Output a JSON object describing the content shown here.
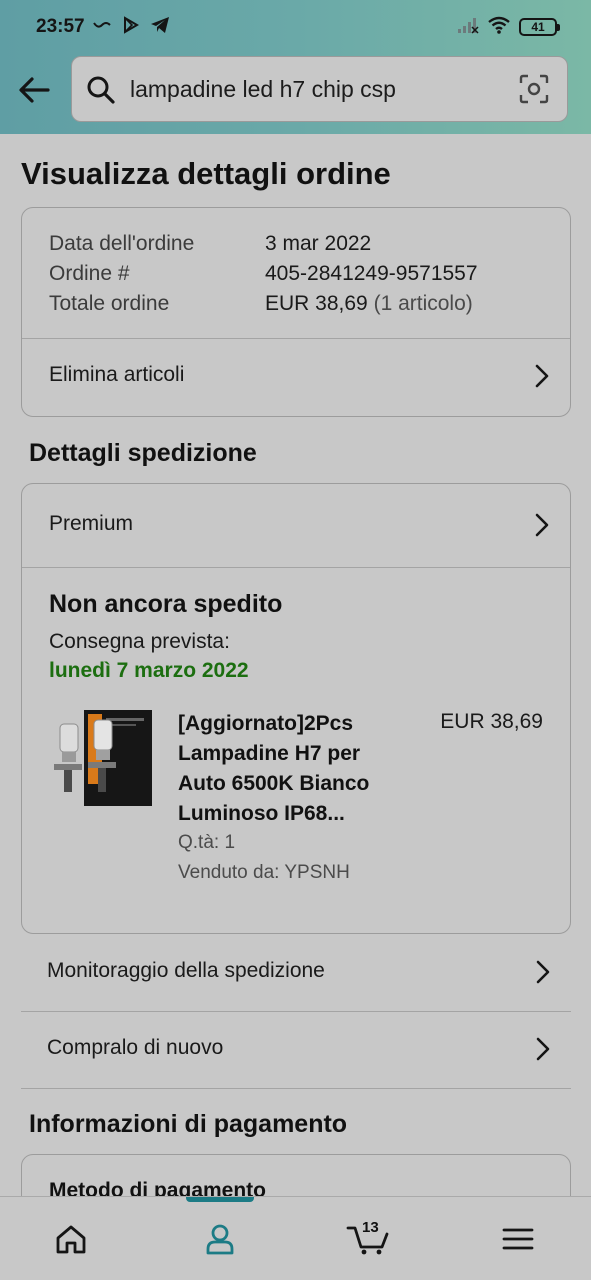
{
  "status_bar": {
    "time": "23:57",
    "battery": "41",
    "icons_left": [
      "tilde-icon",
      "play-store-icon",
      "telegram-icon"
    ],
    "icons_right": [
      "signal-icon",
      "wifi-icon",
      "battery-icon"
    ]
  },
  "search": {
    "query": "lampadine led h7 chip csp",
    "icons": [
      "search-icon",
      "camera-icon"
    ]
  },
  "page_title": "Visualizza dettagli ordine",
  "order_summary": {
    "date_label": "Data dell'ordine",
    "date_value": "3 mar 2022",
    "order_label": "Ordine #",
    "order_value": "405-2841249-9571557",
    "total_label": "Totale ordine",
    "total_value": "EUR 38,69",
    "total_items": "(1 articolo)",
    "delete_items": "Elimina articoli"
  },
  "shipping": {
    "section_title": "Dettagli spedizione",
    "method": "Premium",
    "status": "Non ancora spedito",
    "delivery_label": "Consegna prevista:",
    "delivery_date": "lunedì 7 marzo 2022",
    "product": {
      "title": "[Aggiornato]2Pcs Lampadine H7 per Auto 6500K Bianco Luminoso IP68...",
      "price": "EUR 38,69",
      "qty": "Q.tà: 1",
      "seller": "Venduto da: YPSNH"
    }
  },
  "actions": {
    "track": "Monitoraggio della spedizione",
    "buy_again": "Compralo di nuovo"
  },
  "payment": {
    "section_title": "Informazioni di pagamento",
    "method_label": "Metodo di pagamento"
  },
  "bottom_nav": {
    "cart_count": "13",
    "items": [
      "home-icon",
      "account-icon",
      "cart-icon",
      "menu-icon"
    ],
    "active": "account-icon"
  },
  "colors": {
    "header_gradient_start": "#5f9ea4",
    "header_gradient_end": "#7bb8a6",
    "delivery_green": "#1c6e10",
    "nav_active": "#1c7b85"
  }
}
